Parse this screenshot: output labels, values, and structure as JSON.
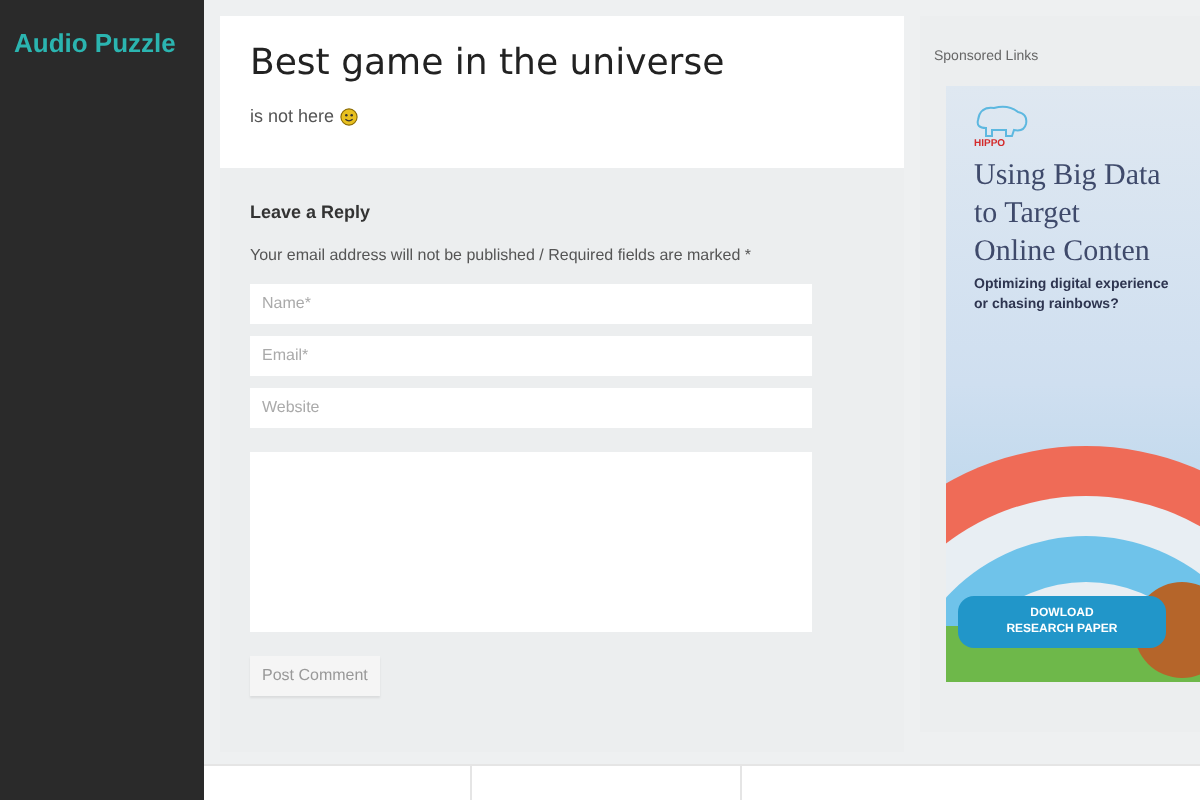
{
  "site_title": "Audio Puzzle",
  "post": {
    "title": "Best game in the universe",
    "body": "is not here"
  },
  "reply": {
    "heading": "Leave a Reply",
    "note": "Your email address will not be published / Required fields are marked *",
    "fields": [
      {
        "kind": "line",
        "placeholder": "Name*"
      },
      {
        "kind": "line",
        "placeholder": "Email*"
      },
      {
        "kind": "line",
        "placeholder": "Website"
      },
      {
        "kind": "area"
      }
    ],
    "submit": "Post Comment"
  },
  "sidebar": {
    "heading": "Sponsored Links",
    "ad": {
      "brand": "HIPPO",
      "headline": [
        "Using Big Data",
        "to Target",
        "Online Conten"
      ],
      "subline": [
        "Optimizing digital experience",
        "or chasing rainbows?"
      ],
      "cta": [
        "DOWLOAD",
        "RESEARCH PAPER"
      ]
    }
  }
}
